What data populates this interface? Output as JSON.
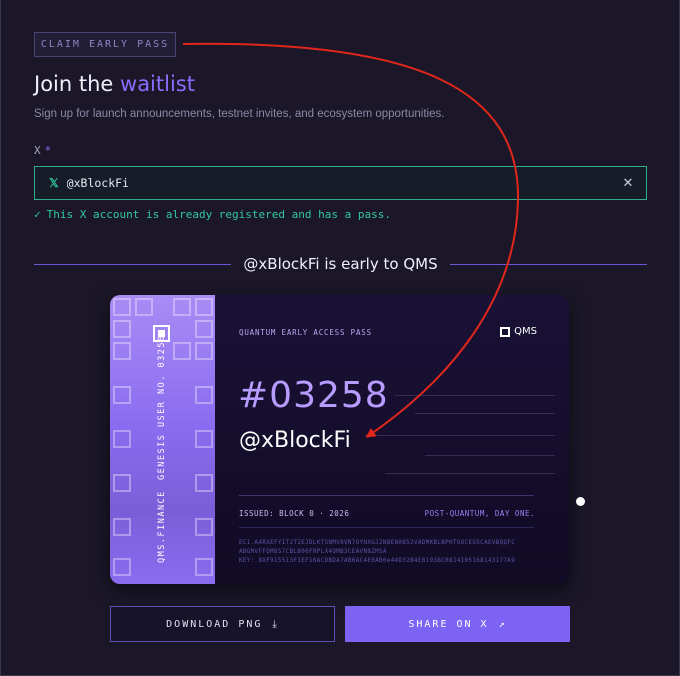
{
  "badge": "CLAIM EARLY PASS",
  "heading": {
    "prefix": "Join the",
    "accent": "waitlist"
  },
  "subtitle": "Sign up for launch announcements, testnet invites, and ecosystem opportunities.",
  "form": {
    "label": "X",
    "required_mark": "*",
    "x_icon": "𝕏",
    "value": "@xBlockFi",
    "clear_icon": "✕",
    "success_icon": "✓",
    "success": "This X account is already registered and has a pass."
  },
  "divider": "@xBlockFi is early to QMS",
  "card": {
    "stripe_top": "GENESIS USER NO. 03258",
    "stripe_bottom": "QMS.FINANCE",
    "eyebrow": "QUANTUM EARLY ACCESS PASS",
    "logo": "QMS",
    "number": "#03258",
    "handle": "@xBlockFi",
    "issued": "ISSUED: BLOCK 0 · 2026",
    "tagline": "POST-QUANTUM, DAY ONE.",
    "key_lines": [
      "EC1.A4RXEFYIT2T2EJDLKTSNMV8VN7OYNXGJ2NBEN0852VADMKBLBPHTGUCEG5CAEVBQQFC",
      "ABGMVFFQM8S7CBLB06FRPLX4OMB3CEAVN8ZM5A",
      "KEY: 8XF915513F1EF16ACDBDA7AB6AC4E0AB0e44D32B4E6193BC0814105168143177A9"
    ]
  },
  "buttons": {
    "download": "DOWNLOAD PNG",
    "download_icon": "⤓",
    "share": "SHARE ON X",
    "share_icon": "↗"
  },
  "colors": {
    "accent": "#8b6cff",
    "success": "#33c99a",
    "annotation_arrow": "#e0271c"
  }
}
